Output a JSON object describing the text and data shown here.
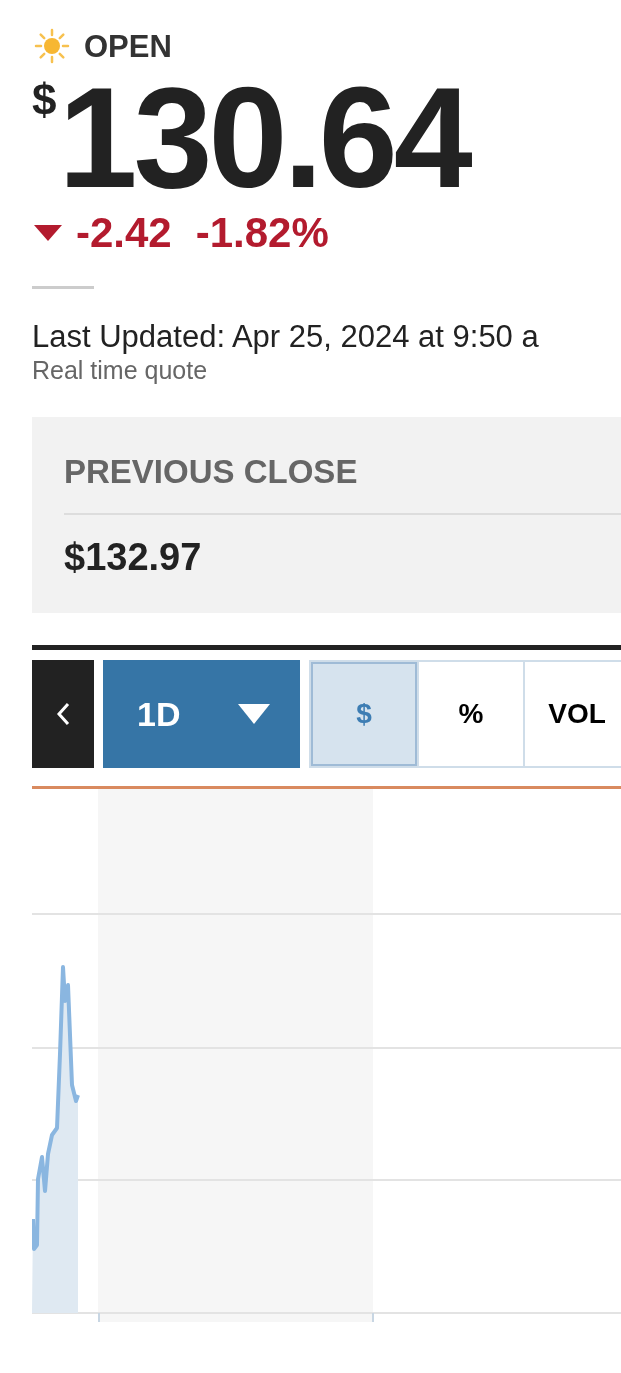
{
  "market_status": {
    "label": "OPEN",
    "open": true
  },
  "quote": {
    "currency": "$",
    "price": "130.64",
    "falling": true,
    "change": "-2.42",
    "change_percent": "-1.82%"
  },
  "last_updated": "Last Updated: Apr 25, 2024 at 9:50 a",
  "quote_note": "Real time quote",
  "previous_close": {
    "label": "PREVIOUS CLOSE",
    "value": "$132.97"
  },
  "chart_controls": {
    "range": "1D",
    "modes": [
      {
        "label": "$",
        "selected": true
      },
      {
        "label": "%",
        "selected": false
      },
      {
        "label": "VOL",
        "selected": false
      }
    ]
  }
}
